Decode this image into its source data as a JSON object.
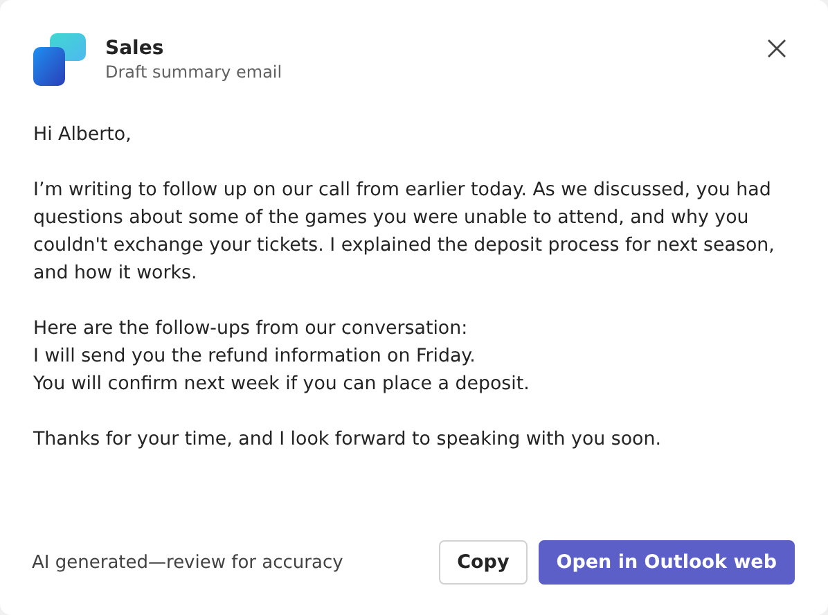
{
  "header": {
    "title": "Sales",
    "subtitle": "Draft summary email"
  },
  "paragraphs": [
    [
      "Hi Alberto,"
    ],
    [
      "I’m writing to follow up on our call from earlier today. As we discussed, you had questions about some of the games you were unable to attend, and why you couldn't exchange your tickets. I explained the deposit process for next season, and how it works."
    ],
    [
      "Here are the follow-ups from our conversation:",
      "I will send you the refund information on Friday.",
      "You will confirm next week if you can place a deposit."
    ],
    [
      "Thanks for your time, and I look forward to speaking with you soon."
    ]
  ],
  "footer": {
    "disclaimer": "AI generated—review for accuracy",
    "buttons": [
      {
        "label": "Copy",
        "kind": "secondary"
      },
      {
        "label": "Open in Outlook web",
        "kind": "primary"
      }
    ]
  }
}
